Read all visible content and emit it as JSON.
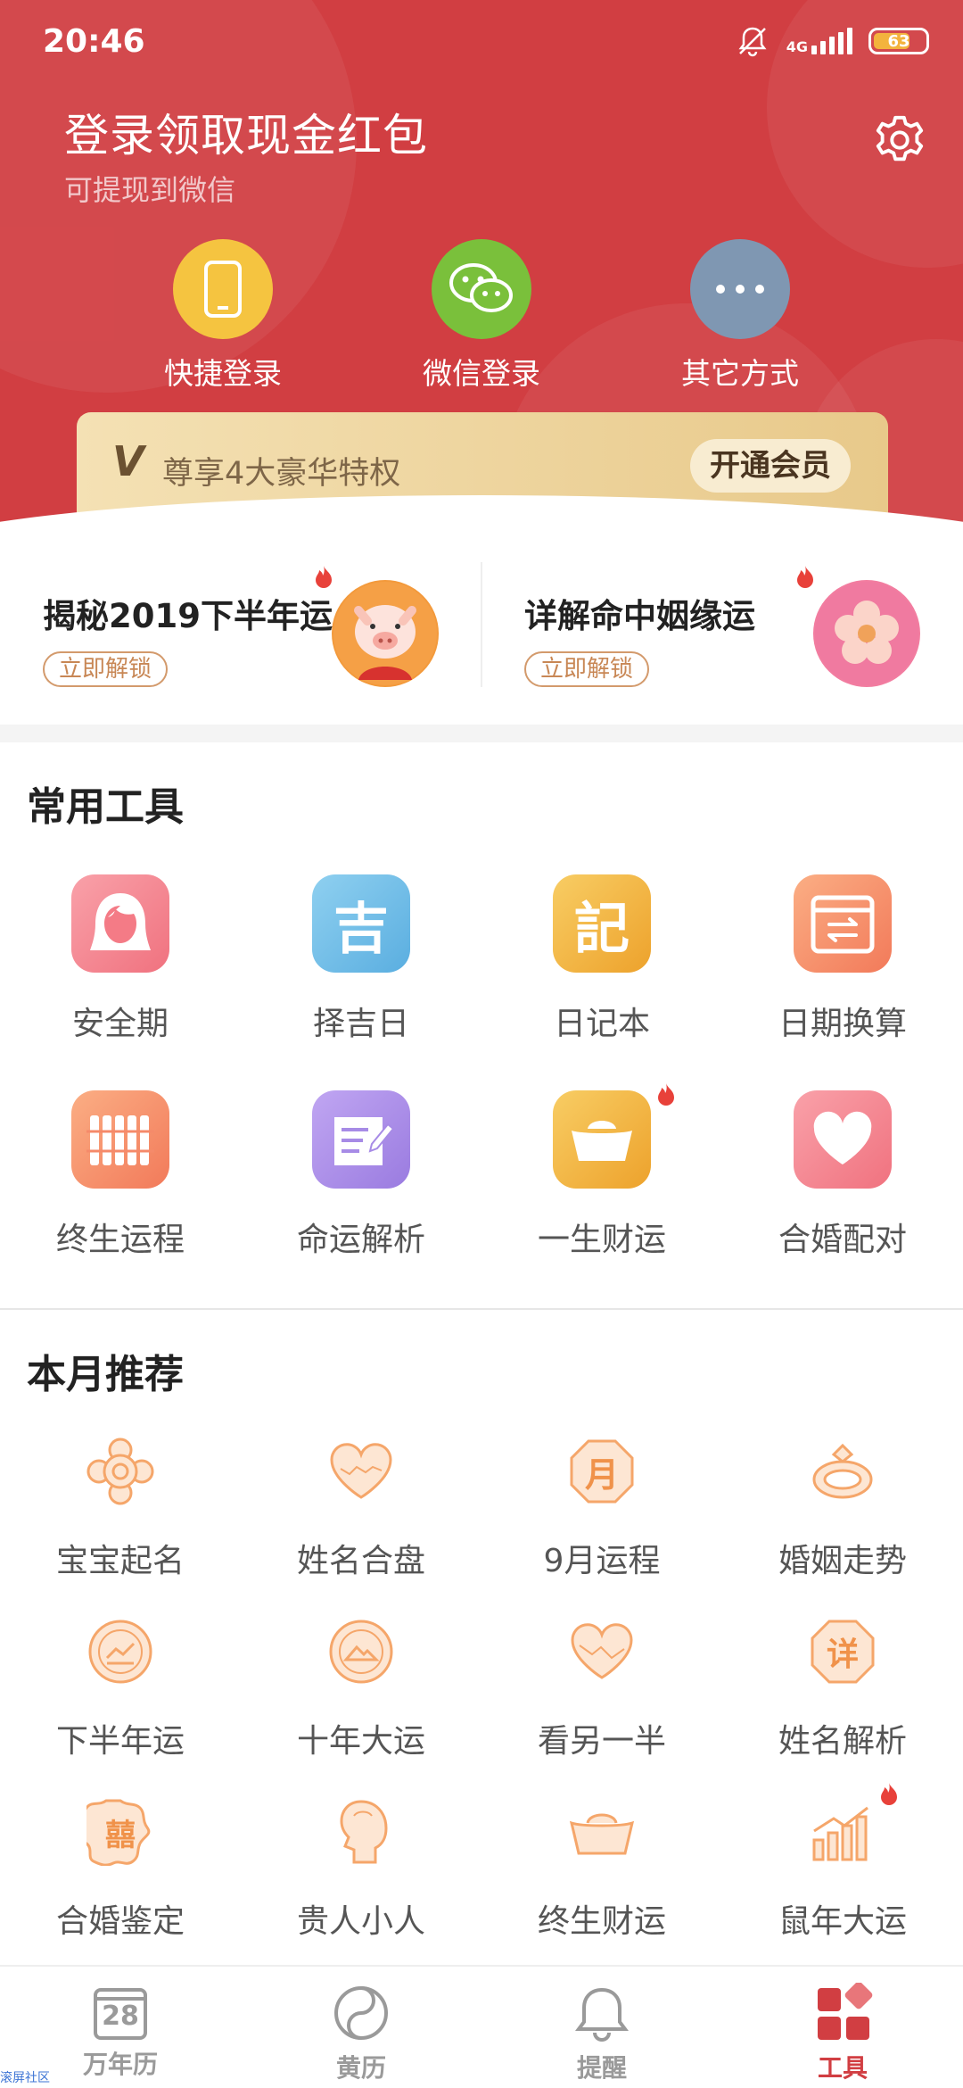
{
  "status_bar": {
    "time": "20:46",
    "network": "4G",
    "battery": "63"
  },
  "header": {
    "title": "登录领取现金红包",
    "subtitle": "可提现到微信",
    "login_options": [
      {
        "label": "快捷登录",
        "icon": "phone-icon",
        "color": "#f5c440"
      },
      {
        "label": "微信登录",
        "icon": "wechat-icon",
        "color": "#7ac03b"
      },
      {
        "label": "其它方式",
        "icon": "more-icon",
        "color": "#7f97b2"
      }
    ]
  },
  "vip": {
    "logo": "V",
    "text": "尊享4大豪华特权",
    "button": "开通会员"
  },
  "promos": [
    {
      "title": "揭秘2019下半年运",
      "button": "立即解锁",
      "icon": "pig-icon"
    },
    {
      "title": "详解命中姻缘运",
      "button": "立即解锁",
      "icon": "flower-icon"
    }
  ],
  "common_tools": {
    "title": "常用工具",
    "items": [
      {
        "label": "安全期",
        "icon": "woman-icon",
        "glyph": "",
        "color": "#f47b86"
      },
      {
        "label": "择吉日",
        "icon": "ji-character-icon",
        "glyph": "吉",
        "color": "#6fb9e6"
      },
      {
        "label": "日记本",
        "icon": "ji-diary-icon",
        "glyph": "記",
        "color": "#f2b340"
      },
      {
        "label": "日期换算",
        "icon": "calendar-convert-icon",
        "glyph": "",
        "color": "#f58a6a"
      },
      {
        "label": "终生运程",
        "icon": "bamboo-icon",
        "glyph": "",
        "color": "#f58a6a"
      },
      {
        "label": "命运解析",
        "icon": "book-icon",
        "glyph": "",
        "color": "#a78be6"
      },
      {
        "label": "一生财运",
        "icon": "gold-ingot-icon",
        "glyph": "",
        "color": "#f2b340",
        "hot": true
      },
      {
        "label": "合婚配对",
        "icon": "heart-icon",
        "glyph": "",
        "color": "#f47b86"
      }
    ]
  },
  "monthly": {
    "title": "本月推荐",
    "items": [
      {
        "label": "宝宝起名",
        "icon": "flower-badge-icon",
        "glyph": ""
      },
      {
        "label": "姓名合盘",
        "icon": "heart-outline-icon",
        "glyph": ""
      },
      {
        "label": "9月运程",
        "icon": "month-octagon-icon",
        "glyph": "月"
      },
      {
        "label": "婚姻走势",
        "icon": "ring-icon",
        "glyph": ""
      },
      {
        "label": "下半年运",
        "icon": "trend-circle-icon",
        "glyph": ""
      },
      {
        "label": "十年大运",
        "icon": "mountain-circle-icon",
        "glyph": ""
      },
      {
        "label": "看另一半",
        "icon": "heart-line-icon",
        "glyph": ""
      },
      {
        "label": "姓名解析",
        "icon": "xiang-octagon-icon",
        "glyph": "详"
      },
      {
        "label": "合婚鉴定",
        "icon": "double-happiness-icon",
        "glyph": "囍"
      },
      {
        "label": "贵人小人",
        "icon": "person-profile-icon",
        "glyph": ""
      },
      {
        "label": "终生财运",
        "icon": "ingot-outline-icon",
        "glyph": ""
      },
      {
        "label": "鼠年大运",
        "icon": "bar-chart-icon",
        "glyph": "",
        "hot": true
      }
    ]
  },
  "tabbar": [
    {
      "label": "万年历",
      "icon": "calendar-icon",
      "badge": "28"
    },
    {
      "label": "黄历",
      "icon": "yin-yang-icon"
    },
    {
      "label": "提醒",
      "icon": "bell-icon"
    },
    {
      "label": "工具",
      "icon": "tools-grid-icon",
      "active": true
    }
  ],
  "watermark": "滚屏社区",
  "colors": {
    "primary": "#d13e42",
    "accent_orange": "#f5a66a",
    "hot": "#e8413a"
  }
}
